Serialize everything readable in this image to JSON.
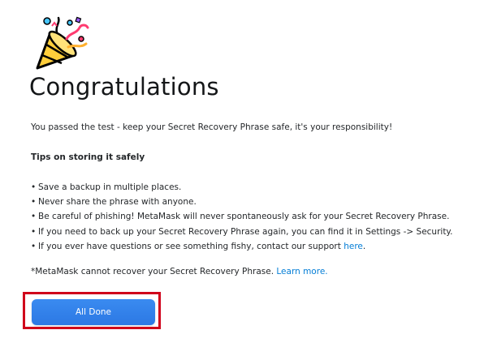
{
  "header": {
    "emoji_icon": "party-popper-icon",
    "title": "Congratulations"
  },
  "main": {
    "intro": "You passed the test - keep your Secret Recovery Phrase safe, it's your responsibility!",
    "tips_heading": "Tips on storing it safely",
    "tips": [
      {
        "text": "Save a backup in multiple places."
      },
      {
        "text": "Never share the phrase with anyone."
      },
      {
        "text": "Be careful of phishing! MetaMask will never spontaneously ask for your Secret Recovery Phrase."
      },
      {
        "text": "If you need to back up your Secret Recovery Phrase again, you can find it in Settings -> Security."
      },
      {
        "text": "If you ever have questions or see something fishy, contact our support ",
        "link": "here",
        "suffix": "."
      }
    ],
    "bullet": "•",
    "disclaimer": "*MetaMask cannot recover your Secret Recovery Phrase. ",
    "disclaimer_link": "Learn more."
  },
  "actions": {
    "done_label": "All Done"
  },
  "colors": {
    "button": "#2f80ed",
    "link": "#037dd6",
    "highlight": "#d0021b"
  }
}
